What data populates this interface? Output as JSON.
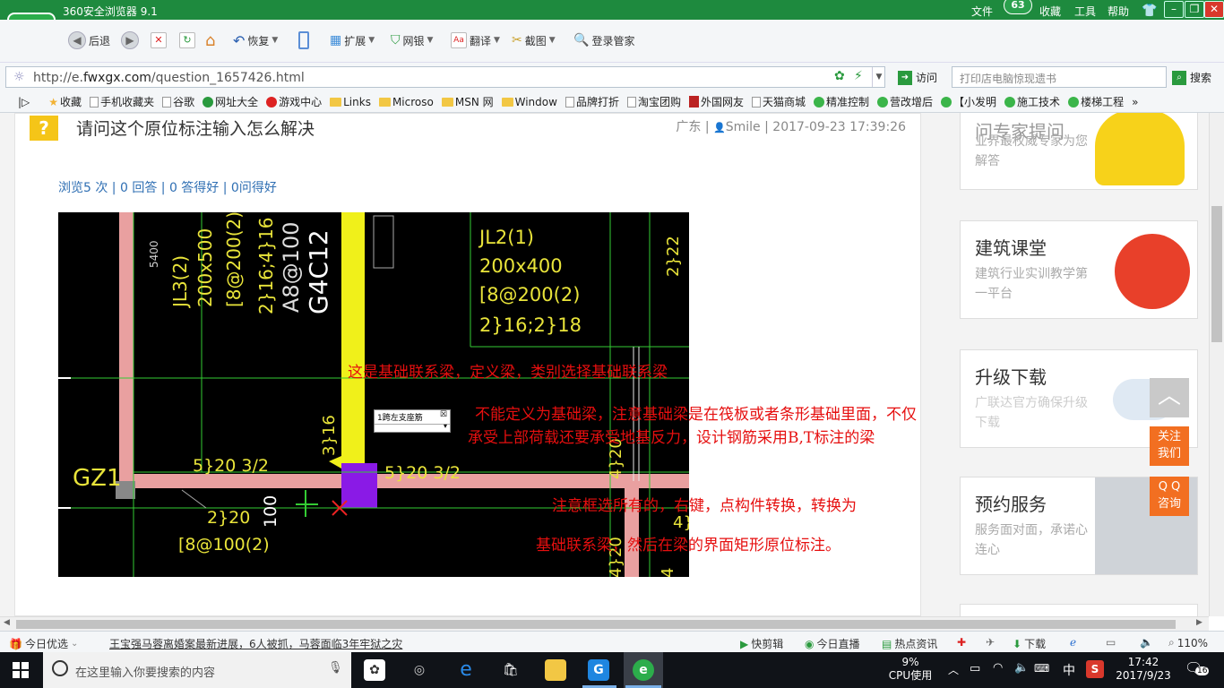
{
  "browser": {
    "title": "360安全浏览器 9.1",
    "menu": [
      "文件",
      "收藏",
      "工具",
      "帮助"
    ],
    "badge_count": "63",
    "toolbar": {
      "back": "后退",
      "restore": "恢复",
      "extend": "扩展",
      "bank": "网银",
      "translate": "翻译",
      "screenshot": "截图",
      "login_manager": "登录管家"
    },
    "address": {
      "prefix": "http://e.",
      "domain": "fwxgx.com",
      "path": "/question_1657426.html",
      "go": "访问",
      "search_placeholder": "打印店电脑惊现遗书",
      "search_button": "搜索"
    },
    "bookmarks": [
      "收藏",
      "手机收藏夹",
      "谷歌",
      "网址大全",
      "游戏中心",
      "Links",
      "Microso",
      "MSN 网",
      "Window",
      "品牌打折",
      "淘宝团购",
      "外国网友",
      "天猫商城",
      "精准控制",
      "营改增后",
      "【小发明",
      "施工技术",
      "楼梯工程"
    ]
  },
  "question": {
    "title": "请问这个原位标注输入怎么解决",
    "region": "广东",
    "user": "Smile",
    "datetime": "2017-09-23 17:39:26",
    "stats": "浏览5 次 | 0 回答 | 0 答得好 | 0问得好"
  },
  "cad": {
    "labels": {
      "jl2": "JL2(1)",
      "jl2_size": "200x400",
      "jl2_stirrup": "[8@200(2)",
      "jl2_bars": "2}16;2}18",
      "jl3": "JL3(2)",
      "jl3_size": "200x500",
      "jl3_stirrup": "[8@200(2)",
      "dim_5400": "5400",
      "col_text": "2}16;4}16",
      "g4c12": "G4C12",
      "a8": "A8@100",
      "bars_5_20_left": "5}20 3/2",
      "bars_5_20_right": "5}20 3/2",
      "bars_2_20": "2}20",
      "stirrup_100": "[8@100(2)",
      "dim_100": "100",
      "v_3_16": "3}16",
      "v_4_20": "4}20",
      "v_2_22": "2}22",
      "v_4": "4}",
      "v_4_20b": "4}20",
      "v_4b": "4",
      "gz1": "GZ1",
      "popup": "1跨左支座筋"
    }
  },
  "annotations": {
    "a1": "这是基础联系梁，定义梁，类别选择基础联系梁",
    "a2": "不能定义为基础梁，注意基础梁是在筏板或者条形基础里面，不仅",
    "a3": "承受上部荷载还要承受地基反力，设计钢筋采用B,T标注的梁",
    "a4": "注意框选所有的，右键，点构件转换，转换为",
    "a5": "基础联系梁，然后在梁的界面矩形原位标注。"
  },
  "sidebar": [
    {
      "title": "问专家提问",
      "sub": "业界最权威专家为您解答"
    },
    {
      "title": "建筑课堂",
      "sub": "建筑行业实训教学第一平台"
    },
    {
      "title": "升级下载",
      "sub": "广联达官方确保升级下载"
    },
    {
      "title": "预约服务",
      "sub": "服务面对面，承诺心连心"
    }
  ],
  "float_buttons": {
    "follow": "关注我们",
    "qq": "Q Q 咨询"
  },
  "statusbar": {
    "today": "今日优选",
    "news": "王宝强马蓉离婚案最新进展，6人被抓，马蓉面临3年牢狱之灾",
    "clip": "快剪辑",
    "live": "今日直播",
    "hot": "热点资讯",
    "download": "下载",
    "zoom": "110%"
  },
  "taskbar": {
    "search_placeholder": "在这里输入你要搜索的内容",
    "cpu_percent": "9%",
    "cpu_label": "CPU使用",
    "ime": "中",
    "time": "17:42",
    "date": "2017/9/23",
    "notif_count": "16"
  },
  "colors": {
    "brand": "#1e8a3e",
    "annotation": "#e60f0f",
    "cad_text": "#e9e43a",
    "float": "#f26f21"
  }
}
